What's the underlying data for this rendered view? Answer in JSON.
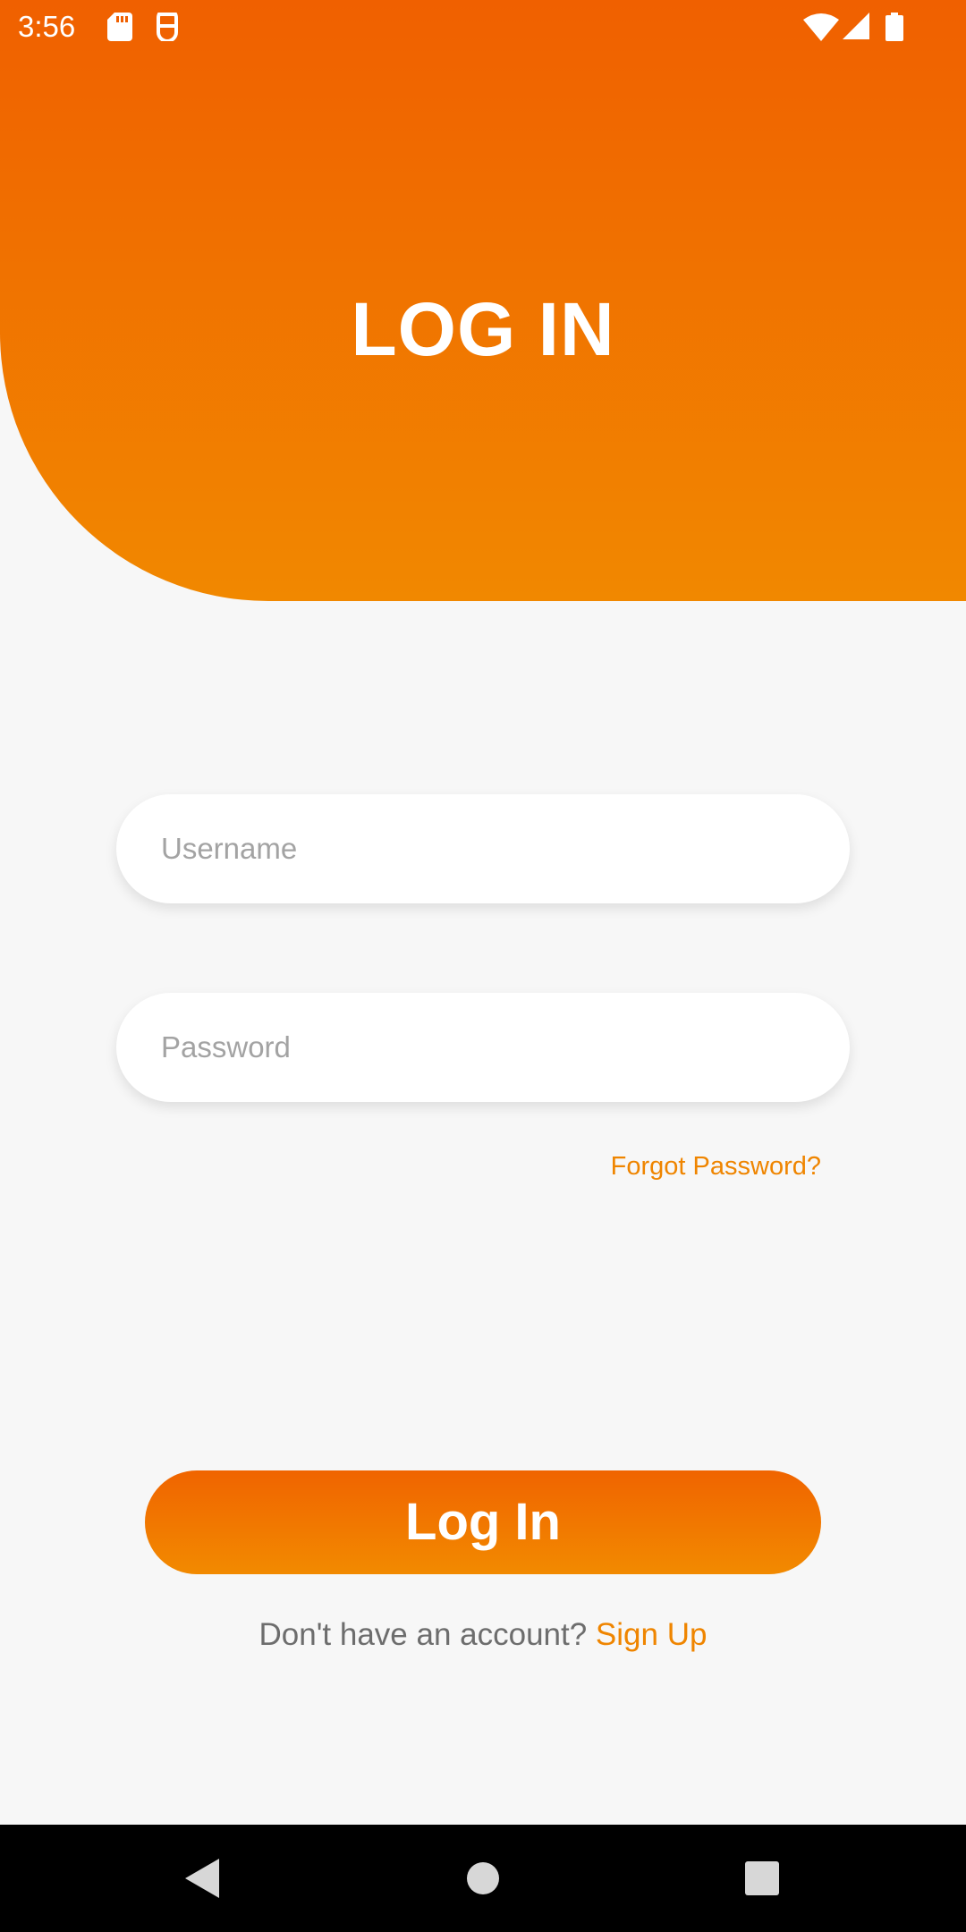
{
  "status_bar": {
    "time": "3:56",
    "icons": [
      "sd-card-icon",
      "recorder-icon",
      "wifi-icon",
      "signal-icon",
      "battery-icon"
    ]
  },
  "header": {
    "title": "LOG IN",
    "gradient_top": "#f06000",
    "gradient_bottom": "#f18800"
  },
  "form": {
    "username_placeholder": "Username",
    "username_value": "",
    "password_placeholder": "Password",
    "password_value": "",
    "forgot_label": "Forgot Password?"
  },
  "actions": {
    "login_label": "Log In",
    "signup_prompt": "Don't have an account? ",
    "signup_label": "Sign Up"
  },
  "nav_bar": {
    "icons": [
      "back-icon",
      "home-icon",
      "recents-icon"
    ]
  },
  "colors": {
    "accent": "#ef8500",
    "background": "#f7f7f7"
  }
}
